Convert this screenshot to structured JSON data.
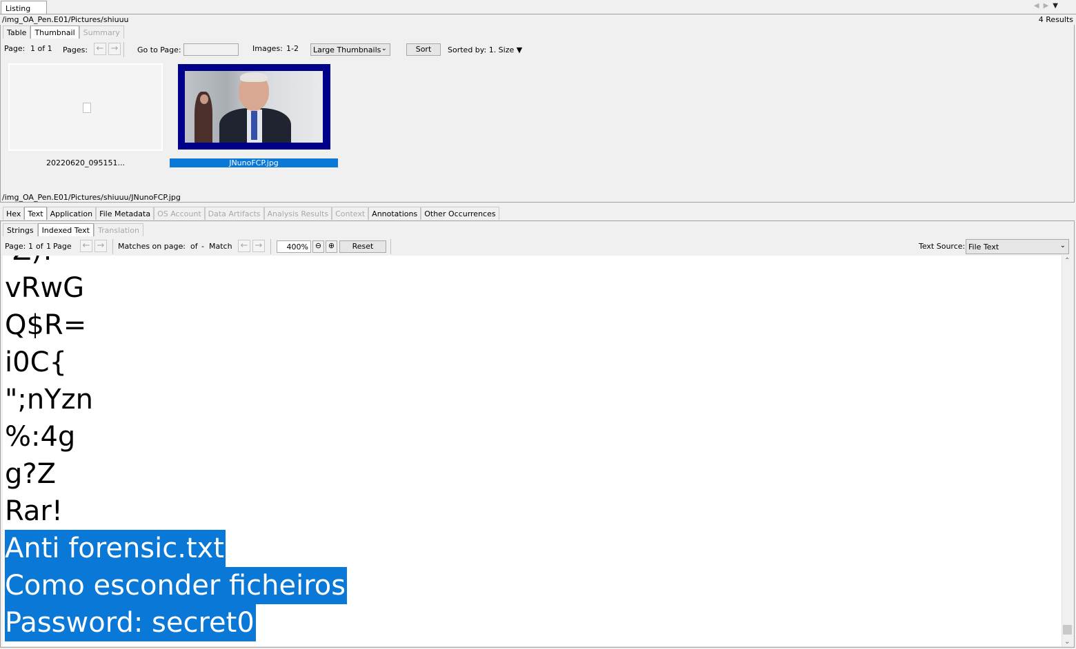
{
  "listing_tab": "Listing",
  "nav_arrows": {
    "left": "◀",
    "right": "▶",
    "menu": "▼"
  },
  "current_path": "/img_OA_Pen.E01/Pictures/shiuuu",
  "results": "4  Results",
  "view_tabs": [
    "Table",
    "Thumbnail",
    "Summary"
  ],
  "thumb_toolbar": {
    "page_label": "Page:",
    "page_value": "1 of 1",
    "pages_label": "Pages:",
    "go_to_page_label": "Go to Page:",
    "images_label": "Images:",
    "images_value": "1-2",
    "size_select": "Large Thumbnails",
    "sort_button": "Sort",
    "sorted_by": "Sorted by: 1. Size ▼"
  },
  "thumbnails": [
    {
      "name": "20220620_095151...",
      "selected": false
    },
    {
      "name": "JNunoFCP.jpg",
      "selected": true
    }
  ],
  "selected_path": "/img_OA_Pen.E01/Pictures/shiuuu/JNunoFCP.jpg",
  "content_tabs": [
    "Hex",
    "Text",
    "Application",
    "File Metadata",
    "OS Account",
    "Data Artifacts",
    "Analysis Results",
    "Context",
    "Annotations",
    "Other Occurrences"
  ],
  "text_subtabs": [
    "Strings",
    "Indexed Text",
    "Translation"
  ],
  "text_toolbar": {
    "page_label": "Page:",
    "page_value": "1",
    "of_label": "of",
    "page_total": "1",
    "page_word": "Page",
    "matches_label": "Matches on page:",
    "matches_value": "-",
    "matches_of": "of",
    "matches_total": "-",
    "match_word": "Match",
    "zoom": "400%",
    "reset_button": "Reset",
    "text_source_label": "Text Source:",
    "text_source_value": "File Text"
  },
  "text_lines": [
    {
      "text": "'Z)!",
      "highlighted": false
    },
    {
      "text": "vRwG",
      "highlighted": false
    },
    {
      "text": "Q$R=",
      "highlighted": false
    },
    {
      "text": "i0C{",
      "highlighted": false
    },
    {
      "text": "\";nYzn",
      "highlighted": false
    },
    {
      "text": "%:4g",
      "highlighted": false
    },
    {
      "text": "g?Z",
      "highlighted": false
    },
    {
      "text": "Rar!",
      "highlighted": false
    },
    {
      "text": "Anti forensic.txt",
      "highlighted": true
    },
    {
      "text": "Como esconder ficheiros",
      "highlighted": true
    },
    {
      "text": "Password: secret0",
      "highlighted": true
    }
  ],
  "colors": {
    "selection": "#0a78d7",
    "thumb_border": "#00008a"
  }
}
